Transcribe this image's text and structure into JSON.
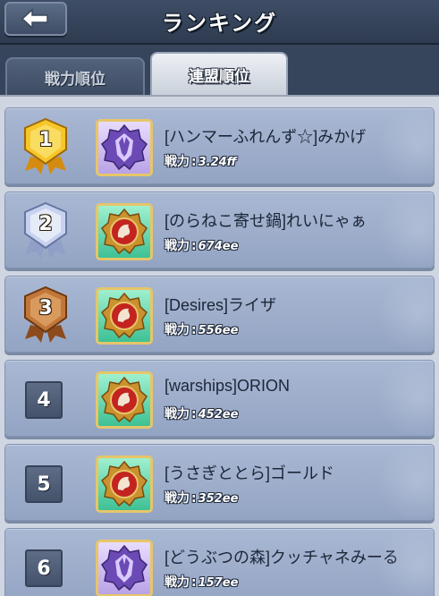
{
  "header": {
    "title": "ランキング",
    "back_icon": "back-arrow-icon"
  },
  "tabs": [
    {
      "label": "戦力順位",
      "active": false
    },
    {
      "label": "連盟順位",
      "active": true
    }
  ],
  "rows": [
    {
      "rank": "1",
      "rank_style": "gold-medal",
      "emblem": "purple-wolf",
      "name": "[ハンマーふれんず☆]みかげ",
      "power_label": "戦力",
      "power_value": "3.24ff"
    },
    {
      "rank": "2",
      "rank_style": "silver-medal",
      "emblem": "red-lion",
      "name": "[のらねこ寄せ鍋]れいにゃぁ",
      "power_label": "戦力",
      "power_value": "674ee"
    },
    {
      "rank": "3",
      "rank_style": "bronze-medal",
      "emblem": "red-lion",
      "name": "[Desires]ライザ",
      "power_label": "戦力",
      "power_value": "556ee"
    },
    {
      "rank": "4",
      "rank_style": "box",
      "emblem": "red-lion",
      "name": "[warships]ORION",
      "power_label": "戦力",
      "power_value": "452ee"
    },
    {
      "rank": "5",
      "rank_style": "box",
      "emblem": "red-lion",
      "name": "[うさぎととら]ゴールド",
      "power_label": "戦力",
      "power_value": "352ee"
    },
    {
      "rank": "6",
      "rank_style": "box",
      "emblem": "purple-wolf",
      "name": "[どうぶつの森]クッチャネみーる",
      "power_label": "戦力",
      "power_value": "157ee"
    }
  ],
  "colors": {
    "gold": "#f2b81c",
    "silver": "#aebbe0",
    "bronze": "#b4662c",
    "row_bg": "#a0b0cd"
  }
}
